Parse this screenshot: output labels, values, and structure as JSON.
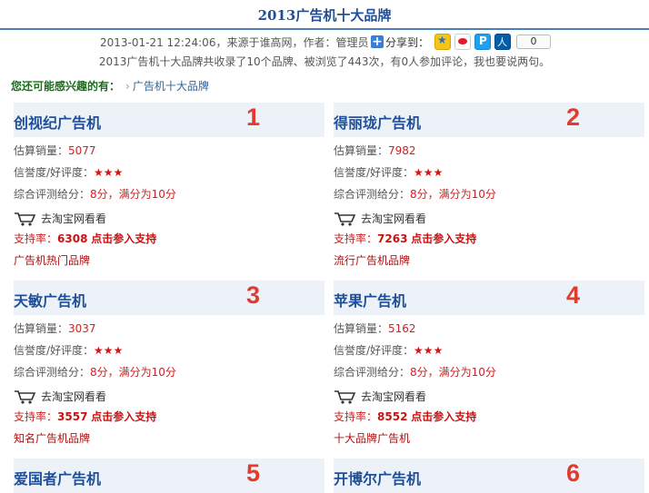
{
  "page_title": "2013广告机十大品牌",
  "meta": {
    "text": "2013-01-21 12:24:06，来源于谁高网，作者：管理员",
    "share_label": "分享到：",
    "share_count": "0"
  },
  "stats": "2013广告机十大品牌共收录了10个品牌、被浏览了443次，有0人参加评论，我也要说两句。",
  "related": {
    "label": "您还可能感兴趣的有：",
    "link": "广告机十大品牌"
  },
  "labels": {
    "sales": "估算销量：",
    "credit": "信誉度/好评度：",
    "rating": "综合评测给分：",
    "rating_suffix": "，满分为10分",
    "taobao": "去淘宝网看看",
    "support": "支持率：",
    "support_action": "点击参入支持"
  },
  "colors": {
    "title_blue": "#1f4f9a",
    "rank_red": "#e23b2e",
    "header_bg": "#edf2f8"
  },
  "brands": [
    {
      "rank": "1",
      "name": "创视纪广告机",
      "sales": "5077",
      "stars": "★★★",
      "score": "8分",
      "support": "6308",
      "tag": "广告机热门品牌"
    },
    {
      "rank": "2",
      "name": "得丽珑广告机",
      "sales": "7982",
      "stars": "★★★",
      "score": "8分",
      "support": "7263",
      "tag": "流行广告机品牌"
    },
    {
      "rank": "3",
      "name": "天敏广告机",
      "sales": "3037",
      "stars": "★★★",
      "score": "8分",
      "support": "3557",
      "tag": "知名广告机品牌"
    },
    {
      "rank": "4",
      "name": "苹果广告机",
      "sales": "5162",
      "stars": "★★★",
      "score": "8分",
      "support": "8552",
      "tag": "十大品牌广告机"
    },
    {
      "rank": "5",
      "name": "爱国者广告机"
    },
    {
      "rank": "6",
      "name": "开博尔广告机"
    }
  ]
}
